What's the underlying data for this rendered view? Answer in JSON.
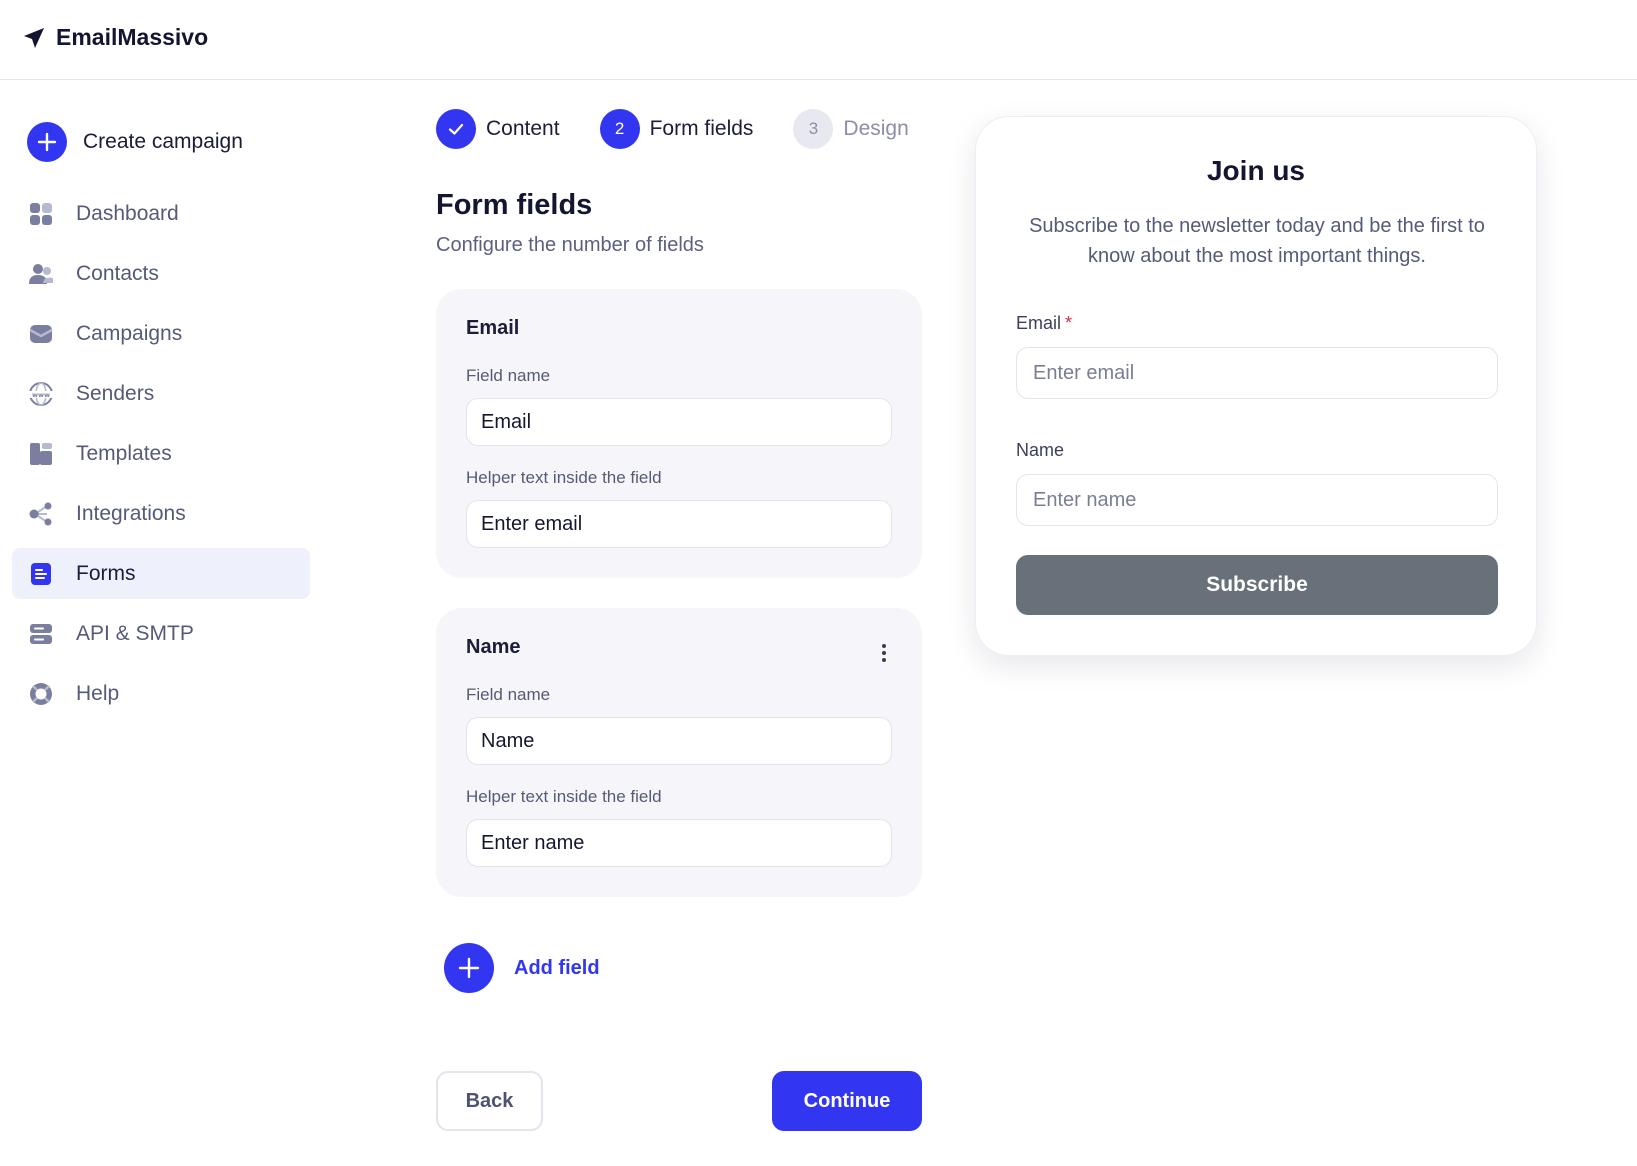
{
  "app": {
    "brand": "EmailMassivo",
    "brand_icon": "send-arrow-icon"
  },
  "sidebar": {
    "create_label": "Create campaign",
    "items": [
      {
        "label": "Dashboard",
        "icon": "dashboard-icon"
      },
      {
        "label": "Contacts",
        "icon": "contacts-icon"
      },
      {
        "label": "Campaigns",
        "icon": "campaigns-icon"
      },
      {
        "label": "Senders",
        "icon": "globe-www-icon"
      },
      {
        "label": "Templates",
        "icon": "templates-icon"
      },
      {
        "label": "Integrations",
        "icon": "integrations-icon"
      },
      {
        "label": "Forms",
        "icon": "forms-icon",
        "active": true
      },
      {
        "label": "API & SMTP",
        "icon": "server-icon"
      },
      {
        "label": "Help",
        "icon": "lifebuoy-icon"
      }
    ]
  },
  "stepper": {
    "steps": [
      {
        "label": "Content",
        "number": "",
        "state": "done"
      },
      {
        "label": "Form fields",
        "number": "2",
        "state": "current"
      },
      {
        "label": "Design",
        "number": "3",
        "state": "pending"
      }
    ]
  },
  "main": {
    "title": "Form fields",
    "subtitle": "Configure the number of fields",
    "fields": [
      {
        "title": "Email",
        "field_name_label": "Field name",
        "field_name_value": "Email",
        "helper_label": "Helper text inside the field",
        "helper_value": "Enter email"
      },
      {
        "title": "Name",
        "field_name_label": "Field name",
        "field_name_value": "Name",
        "helper_label": "Helper text inside the field",
        "helper_value": "Enter name"
      }
    ],
    "add_field_label": "Add field",
    "back_label": "Back",
    "continue_label": "Continue"
  },
  "preview": {
    "title": "Join us",
    "subtitle": "Subscribe to the newsletter today and be the first to know about the most important things.",
    "email_label": "Email",
    "required_mark": "*",
    "email_placeholder": "Enter email",
    "name_label": "Name",
    "name_placeholder": "Enter name",
    "button_label": "Subscribe"
  },
  "colors": {
    "accent": "#3236f0",
    "active_nav_bg": "#eef1fb",
    "card_bg": "#f5f5fa",
    "subscribe_button": "#687079",
    "required": "#e02c3c"
  }
}
